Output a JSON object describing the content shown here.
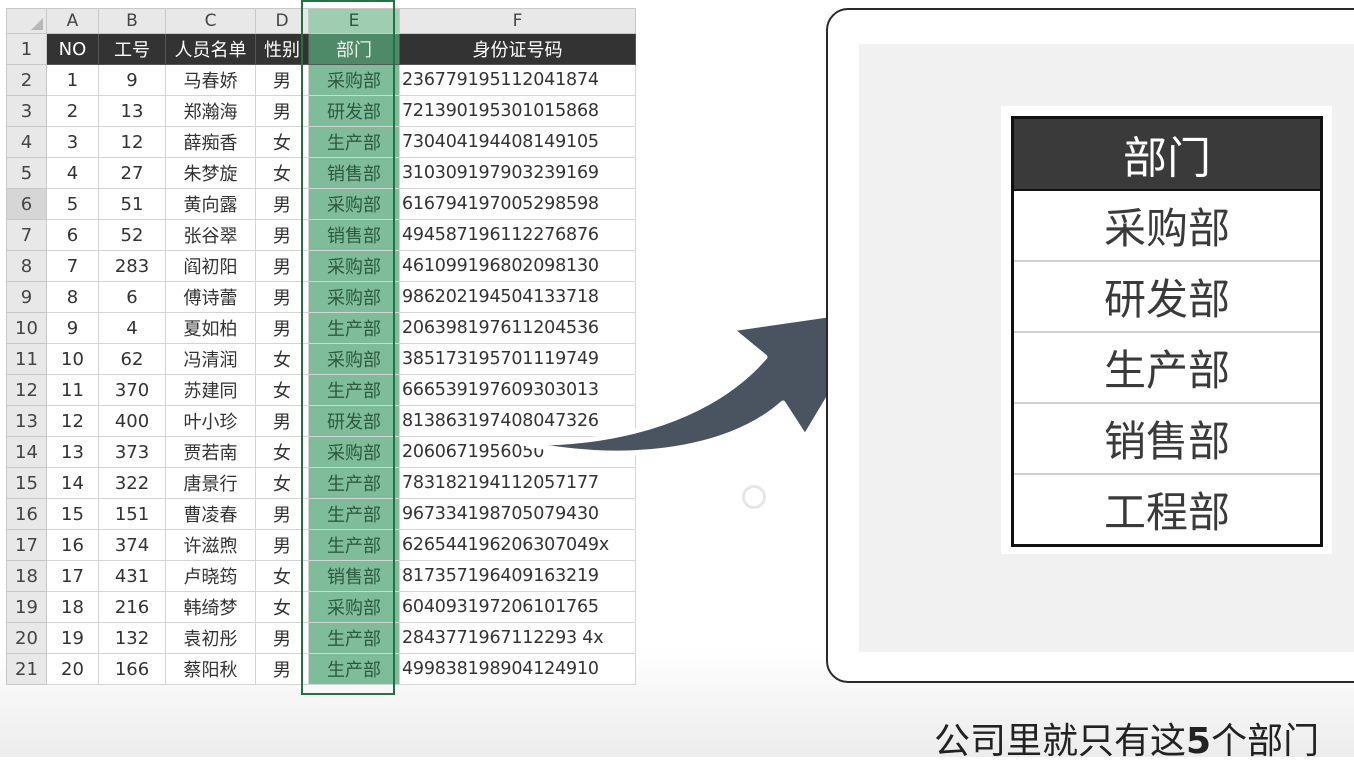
{
  "sheet": {
    "col_letters": [
      "A",
      "B",
      "C",
      "D",
      "E",
      "F"
    ],
    "headers": [
      "NO",
      "工号",
      "人员名单",
      "性别",
      "部门",
      "身份证号码"
    ],
    "rows": [
      [
        "1",
        "9",
        "马春娇",
        "男",
        "采购部",
        "236779195112041874"
      ],
      [
        "2",
        "13",
        "郑瀚海",
        "男",
        "研发部",
        "721390195301015868"
      ],
      [
        "3",
        "12",
        "薛痴香",
        "女",
        "生产部",
        "730404194408149105"
      ],
      [
        "4",
        "27",
        "朱梦旋",
        "女",
        "销售部",
        "310309197903239169"
      ],
      [
        "5",
        "51",
        "黄向露",
        "男",
        "采购部",
        "616794197005298598"
      ],
      [
        "6",
        "52",
        "张谷翠",
        "男",
        "销售部",
        "494587196112276876"
      ],
      [
        "7",
        "283",
        "阎初阳",
        "男",
        "采购部",
        "461099196802098130"
      ],
      [
        "8",
        "6",
        "傅诗蕾",
        "男",
        "采购部",
        "986202194504133718"
      ],
      [
        "9",
        "4",
        "夏如柏",
        "男",
        "生产部",
        "206398197611204536"
      ],
      [
        "10",
        "62",
        "冯清润",
        "女",
        "采购部",
        "385173195701119749"
      ],
      [
        "11",
        "370",
        "苏建同",
        "女",
        "生产部",
        "666539197609303013"
      ],
      [
        "12",
        "400",
        "叶小珍",
        "男",
        "研发部",
        "813863197408047326"
      ],
      [
        "13",
        "373",
        "贾若南",
        "女",
        "采购部",
        "2060671956050"
      ],
      [
        "14",
        "322",
        "唐景行",
        "女",
        "生产部",
        "783182194112057177"
      ],
      [
        "15",
        "151",
        "曹凌春",
        "男",
        "生产部",
        "967334198705079430"
      ],
      [
        "16",
        "374",
        "许滋煦",
        "男",
        "生产部",
        "626544196206307049x"
      ],
      [
        "17",
        "431",
        "卢晓筠",
        "女",
        "销售部",
        "817357196409163219"
      ],
      [
        "18",
        "216",
        "韩绮梦",
        "女",
        "采购部",
        "604093197206101765"
      ],
      [
        "19",
        "132",
        "袁初彤",
        "男",
        "生产部",
        "2843771967112293 4x"
      ],
      [
        "20",
        "166",
        "蔡阳秋",
        "男",
        "生产部",
        "499838198904124910"
      ]
    ],
    "selected_column": "E",
    "selected_row": "6"
  },
  "dept_panel": {
    "header": "部门",
    "items": [
      "采购部",
      "研发部",
      "生产部",
      "销售部",
      "工程部"
    ]
  },
  "caption": {
    "before": "公司里就只有这",
    "number": "5",
    "after": "个部门"
  },
  "colors": {
    "header_bg": "#333333",
    "selection_green": "#217346",
    "column_fill": "#7fbc9a",
    "arrow_fill": "#4a5360"
  }
}
